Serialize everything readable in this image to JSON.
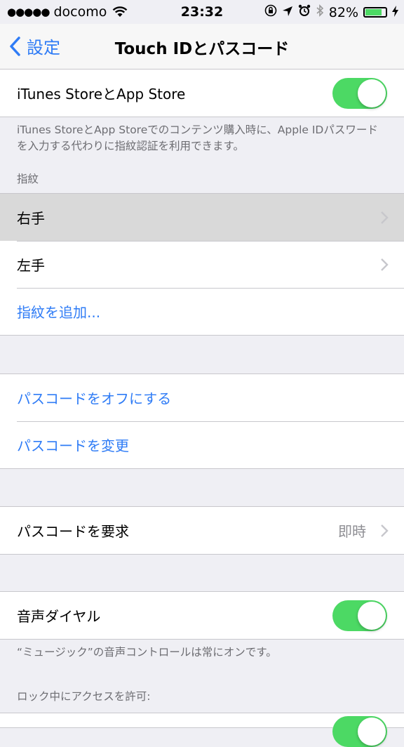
{
  "status_bar": {
    "signal_dots": "●●●●●",
    "carrier": "docomo",
    "time": "23:32",
    "battery_percent": "82%",
    "battery_level": 0.82,
    "icons": [
      "wifi-icon",
      "orientation-lock-icon",
      "location-arrow-icon",
      "alarm-icon",
      "bluetooth-icon",
      "battery-icon",
      "charging-bolt-icon"
    ]
  },
  "nav": {
    "back_label": "設定",
    "title": "Touch IDとパスコード"
  },
  "store_section": {
    "label": "iTunes StoreとApp Store",
    "toggle_on": true,
    "footer": "iTunes StoreとApp Storeでのコンテンツ購入時に、Apple IDパスワードを入力する代わりに指紋認証を利用できます。"
  },
  "fingerprint_section": {
    "header": "指紋",
    "items": [
      "右手",
      "左手"
    ],
    "add_label": "指紋を追加..."
  },
  "passcode_section": {
    "off_label": "パスコードをオフにする",
    "change_label": "パスコードを変更"
  },
  "require_section": {
    "label": "パスコードを要求",
    "value": "即時"
  },
  "voice_section": {
    "label": "音声ダイヤル",
    "toggle_on": true,
    "footer": "“ミュージック”の音声コントロールは常にオンです。"
  },
  "lock_section": {
    "header": "ロック中にアクセスを許可:"
  },
  "colors": {
    "accent": "#2f7cf6",
    "toggle_on": "#4cd964",
    "background": "#efeff4"
  }
}
